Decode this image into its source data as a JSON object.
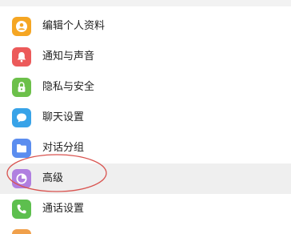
{
  "settings": {
    "items": [
      {
        "label": "编辑个人资料",
        "icon": "profile-icon",
        "color": "#f5a623"
      },
      {
        "label": "通知与声音",
        "icon": "bell-icon",
        "color": "#ec5a5a"
      },
      {
        "label": "隐私与安全",
        "icon": "lock-icon",
        "color": "#6cc04a"
      },
      {
        "label": "聊天设置",
        "icon": "chat-bubble-icon",
        "color": "#38a3e8"
      },
      {
        "label": "对话分组",
        "icon": "folder-icon",
        "color": "#5b8def"
      },
      {
        "label": "高级",
        "icon": "pie-chart-icon",
        "color": "#b07fe0",
        "selected": true
      },
      {
        "label": "通话设置",
        "icon": "phone-icon",
        "color": "#5dbf4e"
      }
    ]
  },
  "annotation": {
    "color": "#d9534f"
  }
}
